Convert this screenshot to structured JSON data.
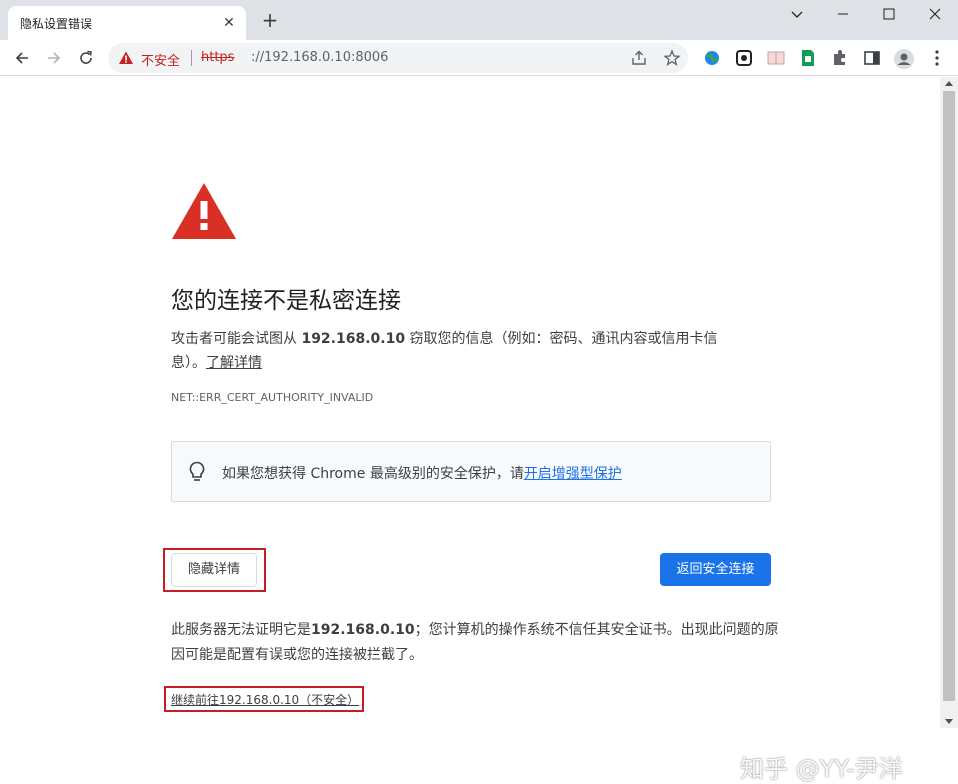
{
  "tab": {
    "title": "隐私设置错误",
    "close": "✕",
    "new_tab": "+"
  },
  "window": {
    "minimize": "minimize",
    "maximize": "maximize",
    "close": "close",
    "tab_search": "tab-search"
  },
  "omnibox": {
    "insecure_label": "不安全",
    "url_scheme": "https",
    "url_rest": "://192.168.0.10:8006"
  },
  "page": {
    "heading": "您的连接不是私密连接",
    "desc_prefix": "攻击者可能会试图从 ",
    "desc_host": "192.168.0.10",
    "desc_suffix": " 窃取您的信息（例如：密码、通讯内容或信用卡信息）。",
    "learn_more": "了解详情",
    "error_code": "NET::ERR_CERT_AUTHORITY_INVALID",
    "tip_text": "如果您想获得 Chrome 最高级别的安全保护，请",
    "tip_link": "开启增强型保护",
    "hide_details": "隐藏详情",
    "back_to_safety": "返回安全连接",
    "detail_prefix": "此服务器无法证明它是",
    "detail_host": "192.168.0.10",
    "detail_suffix": "；您计算机的操作系统不信任其安全证书。出现此问题的原因可能是配置有误或您的连接被拦截了。",
    "proceed_link": "继续前往192.168.0.10（不安全）"
  },
  "watermark": "知乎 @YY-尹洋",
  "colors": {
    "accent": "#1a73e8",
    "danger": "#d93025",
    "highlight_box": "#c41e24"
  }
}
